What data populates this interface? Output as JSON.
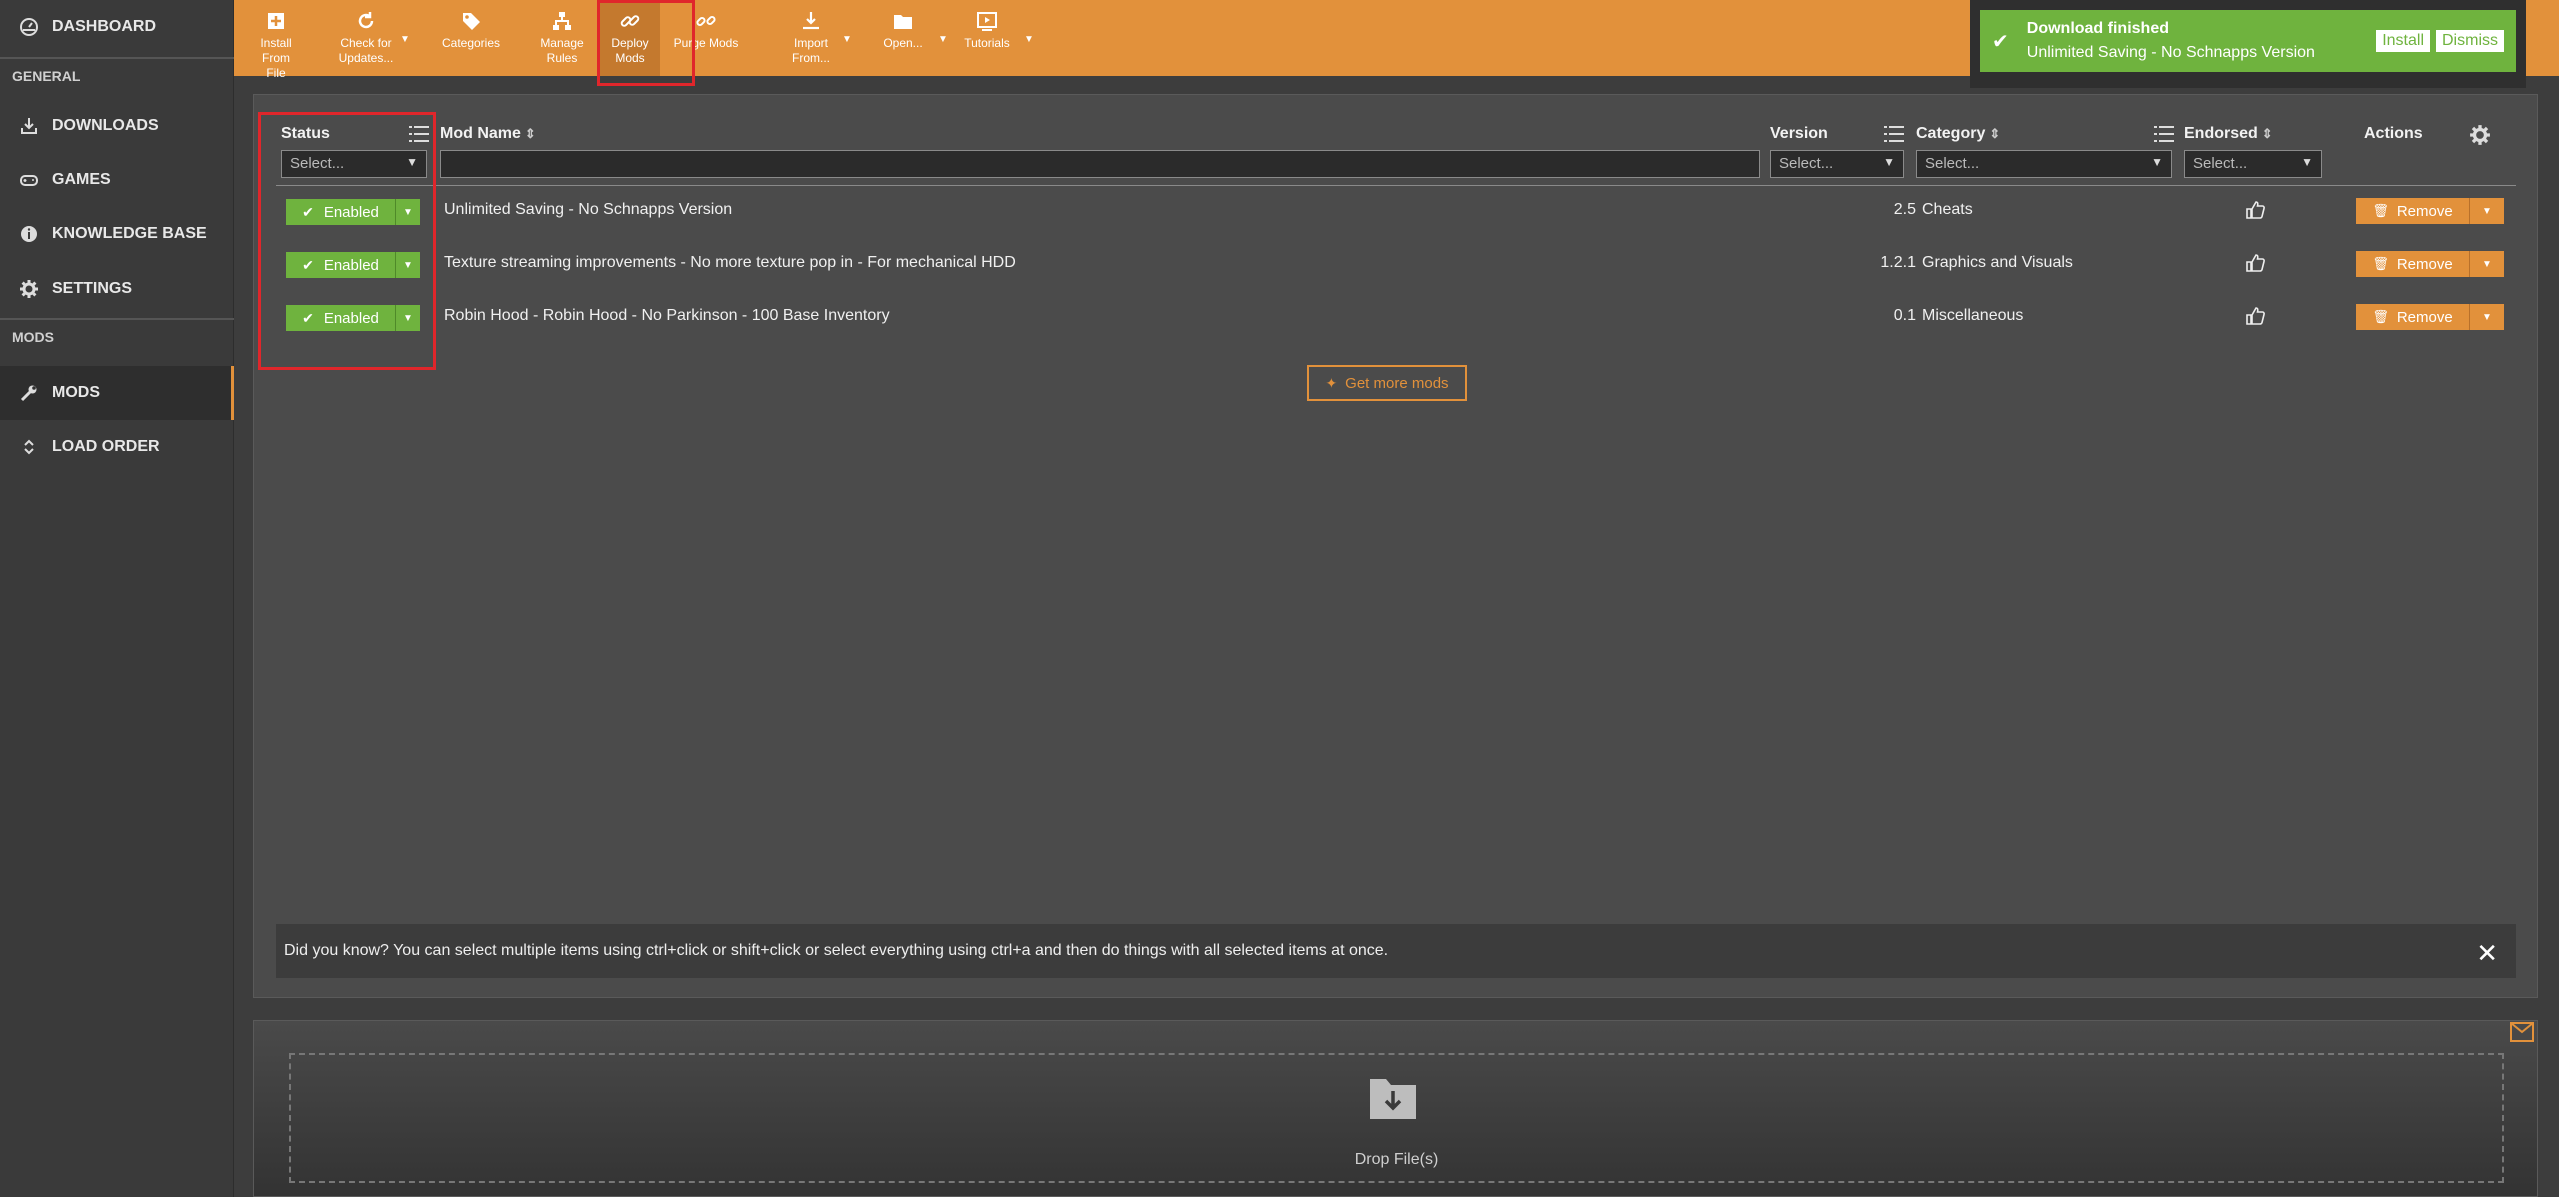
{
  "sidebar": {
    "dashboard": "DASHBOARD",
    "section_general": "GENERAL",
    "downloads": "DOWNLOADS",
    "games": "GAMES",
    "knowledge_base": "KNOWLEDGE BASE",
    "settings": "SETTINGS",
    "section_mods": "MODS",
    "mods": "MODS",
    "load_order": "LOAD ORDER"
  },
  "toolbar": {
    "install_from_file": "Install From\nFile",
    "check_updates": "Check for\nUpdates...",
    "categories": "Categories",
    "manage_rules": "Manage\nRules",
    "deploy_mods": "Deploy Mods",
    "purge_mods": "Purge Mods",
    "import_from": "Import\nFrom...",
    "open": "Open...",
    "tutorials": "Tutorials"
  },
  "notification": {
    "title": "Download finished",
    "message": "Unlimited Saving - No Schnapps Version",
    "install": "Install",
    "dismiss": "Dismiss"
  },
  "table": {
    "headers": {
      "status": "Status",
      "mod_name": "Mod Name",
      "version": "Version",
      "category": "Category",
      "endorsed": "Endorsed",
      "actions": "Actions"
    },
    "filter_placeholder": "Select...",
    "rows": [
      {
        "status": "Enabled",
        "name": "Unlimited Saving - No Schnapps Version",
        "version": "2.5",
        "category": "Cheats",
        "action": "Remove"
      },
      {
        "status": "Enabled",
        "name": "Texture streaming improvements - No more texture pop in - For mechanical HDD",
        "version": "1.2.1",
        "category": "Graphics and Visuals",
        "action": "Remove"
      },
      {
        "status": "Enabled",
        "name": "Robin Hood - Robin Hood - No Parkinson - 100 Base Inventory",
        "version": "0.1",
        "category": "Miscellaneous",
        "action": "Remove"
      }
    ]
  },
  "get_more_mods": "Get more mods",
  "tip": "Did you know? You can select multiple items using ctrl+click or shift+click or select everything using ctrl+a and then do things with all selected items at once.",
  "drop_label": "Drop File(s)",
  "colors": {
    "accent": "#e2913b",
    "enabled": "#6fb33e",
    "highlight": "#e0262b"
  }
}
